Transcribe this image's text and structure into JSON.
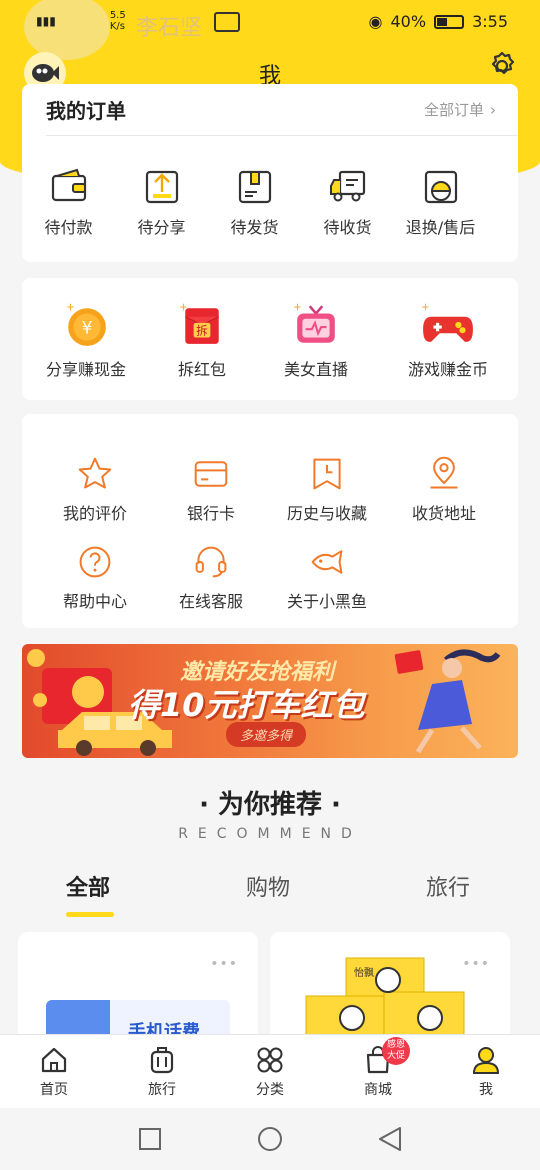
{
  "status": {
    "net_speed": "5.5\nK/s",
    "user_name": "李石坚",
    "battery_text": "40%",
    "battery_level": 0.4,
    "time": "3:55"
  },
  "header": {
    "title": "我"
  },
  "orders": {
    "title": "我的订单",
    "all_label": "全部订单",
    "items": [
      {
        "label": "待付款",
        "icon": "wallet-icon"
      },
      {
        "label": "待分享",
        "icon": "share-icon"
      },
      {
        "label": "待发货",
        "icon": "package-icon"
      },
      {
        "label": "待收货",
        "icon": "truck-icon"
      },
      {
        "label": "退换/售后",
        "icon": "after-sales-icon"
      }
    ]
  },
  "promos": [
    {
      "label": "分享赚现金",
      "icon": "coin-icon",
      "glyph": "¥"
    },
    {
      "label": "拆红包",
      "icon": "red-envelope-icon",
      "glyph": "拆"
    },
    {
      "label": "美女直播",
      "icon": "tv-icon"
    },
    {
      "label": "游戏赚金币",
      "icon": "gamepad-icon"
    }
  ],
  "services": [
    {
      "label": "我的评价",
      "icon": "star-icon"
    },
    {
      "label": "银行卡",
      "icon": "bank-card-icon"
    },
    {
      "label": "历史与收藏",
      "icon": "bookmark-clock-icon"
    },
    {
      "label": "收货地址",
      "icon": "location-icon"
    },
    {
      "label": "帮助中心",
      "icon": "help-icon"
    },
    {
      "label": "在线客服",
      "icon": "headset-icon"
    },
    {
      "label": "关于小黑鱼",
      "icon": "fish-icon"
    }
  ],
  "banner": {
    "line1": "邀请好友抢福利",
    "line2": "得10元打车红包",
    "pill": "多邀多得"
  },
  "recommend": {
    "title": "· 为你推荐 ·",
    "subtitle": "RECOMMEND",
    "tabs": [
      "全部",
      "购物",
      "旅行"
    ],
    "active_tab": 0
  },
  "products": [
    {
      "text": "手机话费",
      "more": "•••"
    },
    {
      "brand": "怡飘",
      "more": "•••"
    }
  ],
  "tabbar": [
    {
      "label": "首页",
      "icon": "home-icon"
    },
    {
      "label": "旅行",
      "icon": "luggage-icon"
    },
    {
      "label": "分类",
      "icon": "category-icon"
    },
    {
      "label": "商城",
      "icon": "shopping-bag-icon",
      "badge": "感恩\n大促"
    },
    {
      "label": "我",
      "icon": "user-icon",
      "active": true
    }
  ],
  "colors": {
    "accent": "#ffd91a",
    "orange": "#f28a2e",
    "red": "#f03a4a"
  }
}
